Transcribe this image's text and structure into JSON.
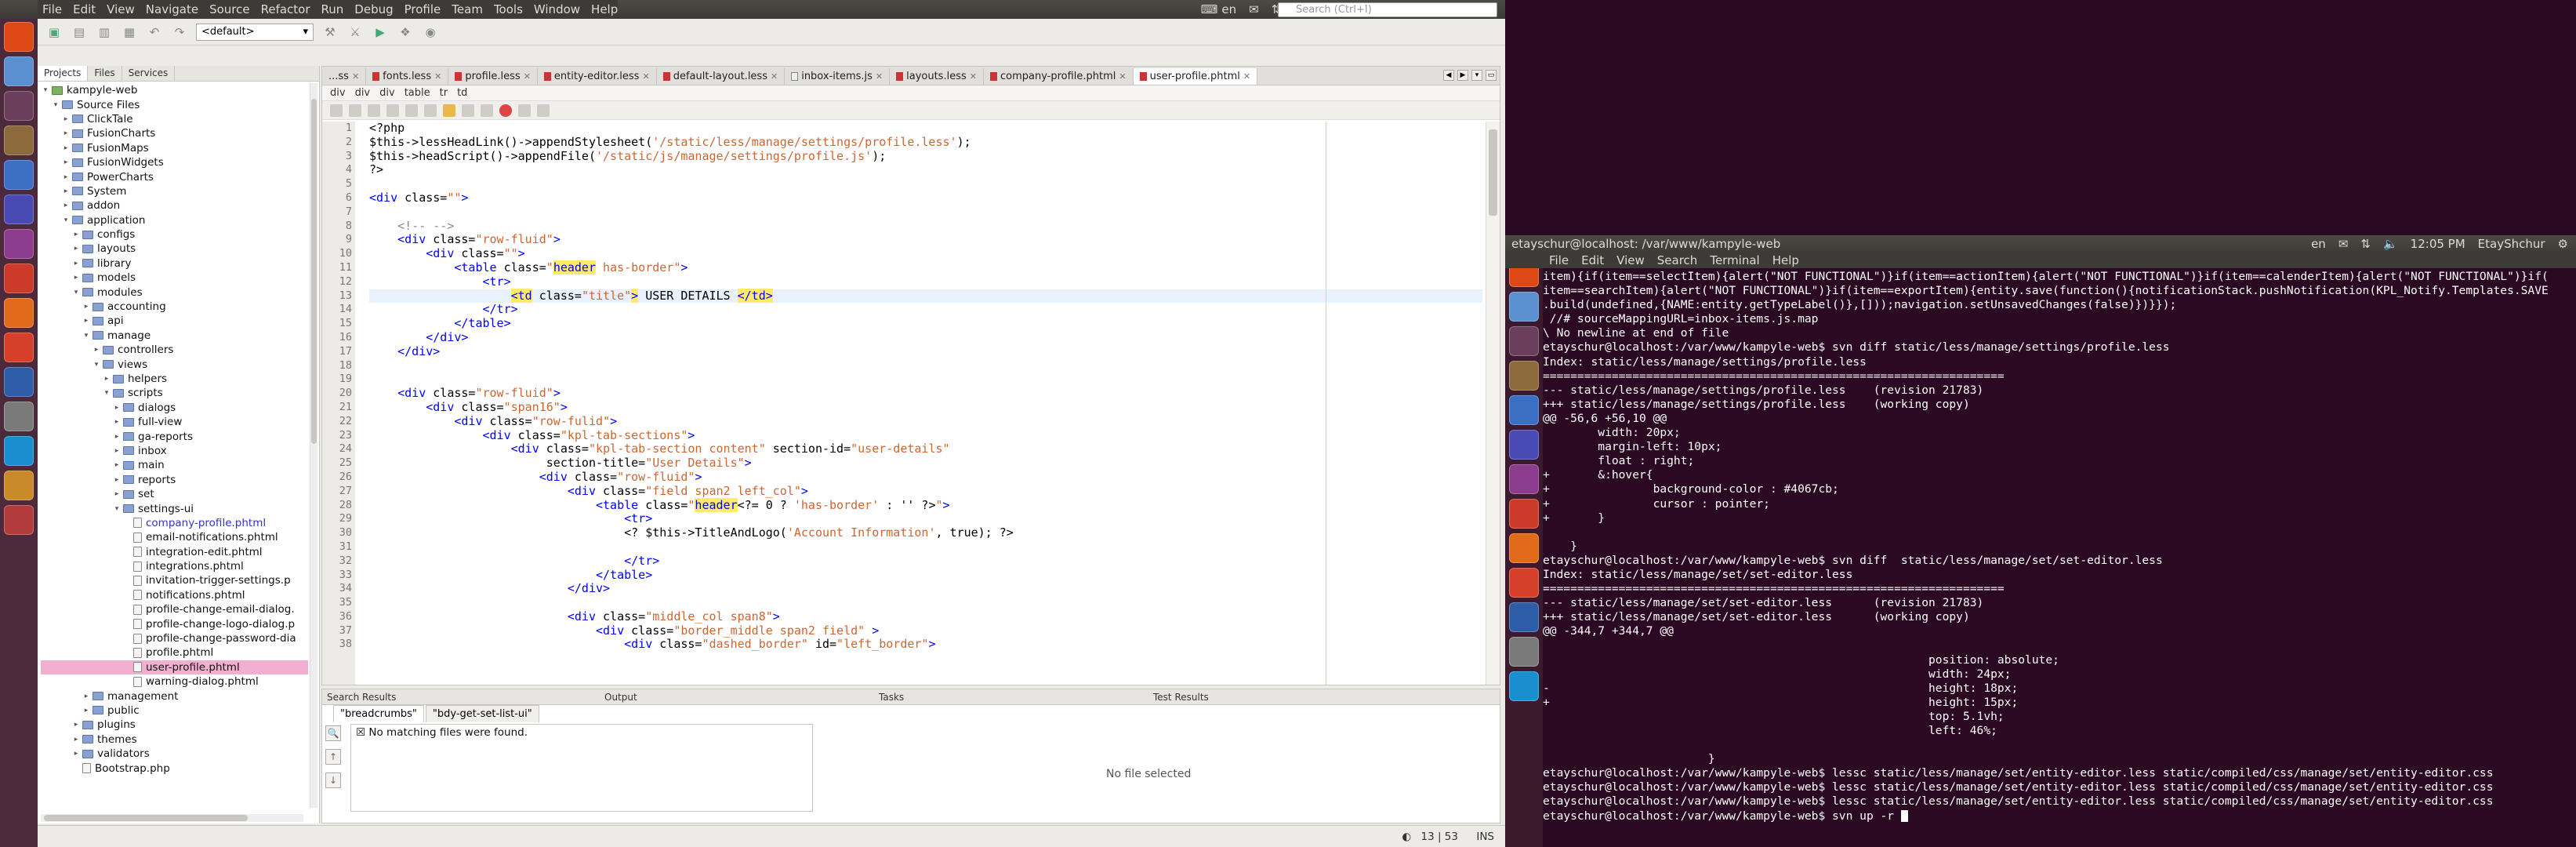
{
  "panel": {
    "keyboard": "en",
    "time": "12:05 PM",
    "user": "EtayShchur"
  },
  "menu": [
    "File",
    "Edit",
    "View",
    "Navigate",
    "Source",
    "Refactor",
    "Run",
    "Debug",
    "Profile",
    "Team",
    "Tools",
    "Window",
    "Help"
  ],
  "search_placeholder": "Search (Ctrl+I)",
  "config_combo": "<default>",
  "panel_tabs": [
    "Projects",
    "Files",
    "Services"
  ],
  "tree": [
    {
      "d": 0,
      "t": "proj",
      "l": "kampyle-web",
      "o": true
    },
    {
      "d": 1,
      "t": "folder",
      "l": "Source Files",
      "o": true
    },
    {
      "d": 2,
      "t": "folder",
      "l": "ClickTale",
      "o": false
    },
    {
      "d": 2,
      "t": "folder",
      "l": "FusionCharts",
      "o": false
    },
    {
      "d": 2,
      "t": "folder",
      "l": "FusionMaps",
      "o": false
    },
    {
      "d": 2,
      "t": "folder",
      "l": "FusionWidgets",
      "o": false
    },
    {
      "d": 2,
      "t": "folder",
      "l": "PowerCharts",
      "o": false
    },
    {
      "d": 2,
      "t": "folder",
      "l": "System",
      "o": false
    },
    {
      "d": 2,
      "t": "folder",
      "l": "addon",
      "o": false
    },
    {
      "d": 2,
      "t": "folder",
      "l": "application",
      "o": true
    },
    {
      "d": 3,
      "t": "folder",
      "l": "configs",
      "o": false
    },
    {
      "d": 3,
      "t": "folder",
      "l": "layouts",
      "o": false
    },
    {
      "d": 3,
      "t": "folder",
      "l": "library",
      "o": false
    },
    {
      "d": 3,
      "t": "folder",
      "l": "models",
      "o": false
    },
    {
      "d": 3,
      "t": "folder",
      "l": "modules",
      "o": true
    },
    {
      "d": 4,
      "t": "folder",
      "l": "accounting",
      "o": false
    },
    {
      "d": 4,
      "t": "folder",
      "l": "api",
      "o": false
    },
    {
      "d": 4,
      "t": "folder",
      "l": "manage",
      "o": true
    },
    {
      "d": 5,
      "t": "folder",
      "l": "controllers",
      "o": false
    },
    {
      "d": 5,
      "t": "folder",
      "l": "views",
      "o": true
    },
    {
      "d": 6,
      "t": "folder",
      "l": "helpers",
      "o": false
    },
    {
      "d": 6,
      "t": "folder",
      "l": "scripts",
      "o": true
    },
    {
      "d": 7,
      "t": "folder",
      "l": "dialogs",
      "o": false
    },
    {
      "d": 7,
      "t": "folder",
      "l": "full-view",
      "o": false
    },
    {
      "d": 7,
      "t": "folder",
      "l": "ga-reports",
      "o": false
    },
    {
      "d": 7,
      "t": "folder",
      "l": "inbox",
      "o": false
    },
    {
      "d": 7,
      "t": "folder",
      "l": "main",
      "o": false
    },
    {
      "d": 7,
      "t": "folder",
      "l": "reports",
      "o": false
    },
    {
      "d": 7,
      "t": "folder",
      "l": "set",
      "o": false
    },
    {
      "d": 7,
      "t": "folder",
      "l": "settings-ui",
      "o": true
    },
    {
      "d": 8,
      "t": "file",
      "l": "company-profile.phtml",
      "f": "open"
    },
    {
      "d": 8,
      "t": "file",
      "l": "email-notifications.phtml"
    },
    {
      "d": 8,
      "t": "file",
      "l": "integration-edit.phtml"
    },
    {
      "d": 8,
      "t": "file",
      "l": "integrations.phtml"
    },
    {
      "d": 8,
      "t": "file",
      "l": "invitation-trigger-settings.p"
    },
    {
      "d": 8,
      "t": "file",
      "l": "notifications.phtml"
    },
    {
      "d": 8,
      "t": "file",
      "l": "profile-change-email-dialog."
    },
    {
      "d": 8,
      "t": "file",
      "l": "profile-change-logo-dialog.p"
    },
    {
      "d": 8,
      "t": "file",
      "l": "profile-change-password-dia"
    },
    {
      "d": 8,
      "t": "file",
      "l": "profile.phtml"
    },
    {
      "d": 8,
      "t": "file",
      "l": "user-profile.phtml",
      "f": "sel"
    },
    {
      "d": 8,
      "t": "file",
      "l": "warning-dialog.phtml"
    },
    {
      "d": 4,
      "t": "folder",
      "l": "management",
      "o": false
    },
    {
      "d": 4,
      "t": "folder",
      "l": "public",
      "o": false
    },
    {
      "d": 3,
      "t": "folder",
      "l": "plugins",
      "o": false
    },
    {
      "d": 3,
      "t": "folder",
      "l": "themes",
      "o": false
    },
    {
      "d": 3,
      "t": "folder",
      "l": "validators",
      "o": false
    },
    {
      "d": 3,
      "t": "file",
      "l": "Bootstrap.php"
    }
  ],
  "editor_tabs": [
    {
      "l": "...ss",
      "ic": ""
    },
    {
      "l": "fonts.less",
      "ic": "less"
    },
    {
      "l": "profile.less",
      "ic": "less"
    },
    {
      "l": "entity-editor.less",
      "ic": "less"
    },
    {
      "l": "default-layout.less",
      "ic": "less"
    },
    {
      "l": "inbox-items.js",
      "ic": "js"
    },
    {
      "l": "layouts.less",
      "ic": "less"
    },
    {
      "l": "company-profile.phtml",
      "ic": "less"
    },
    {
      "l": "user-profile.phtml",
      "ic": "less",
      "on": true
    }
  ],
  "breadcrumbs": [
    "div",
    "div",
    "div",
    "table",
    "tr",
    "td"
  ],
  "code_lines": [
    [
      [
        "php",
        "<?php"
      ]
    ],
    [
      [
        "php",
        "$this->lessHeadLink()->appendStylesheet("
      ],
      [
        "str",
        "'/static/less/manage/settings/profile.less'"
      ],
      [
        "php",
        ");"
      ]
    ],
    [
      [
        "php",
        "$this->headScript()->appendFile("
      ],
      [
        "str",
        "'/static/js/manage/settings/profile.js'"
      ],
      [
        "php",
        ");"
      ]
    ],
    [
      [
        "php",
        "?>"
      ]
    ],
    [],
    [
      [
        "tag",
        "<div "
      ],
      [
        "attr",
        "class="
      ],
      [
        "str",
        "\"\""
      ],
      [
        "tag",
        ">"
      ]
    ],
    [],
    [
      [
        "cm",
        "    <!-- -->"
      ]
    ],
    [
      [
        "tag",
        "    <div "
      ],
      [
        "attr",
        "class="
      ],
      [
        "str",
        "\"row-fluid\""
      ],
      [
        "tag",
        ">"
      ]
    ],
    [
      [
        "tag",
        "        <div "
      ],
      [
        "attr",
        "class="
      ],
      [
        "str",
        "\"\""
      ],
      [
        "tag",
        ">"
      ]
    ],
    [
      [
        "tag",
        "            <table "
      ],
      [
        "attr",
        "class="
      ],
      [
        "str",
        "\""
      ],
      [
        "hl",
        "header"
      ],
      [
        "str",
        " has-border\""
      ],
      [
        "tag",
        ">"
      ]
    ],
    [
      [
        "tag",
        "                <tr>"
      ]
    ],
    [
      [
        "tag",
        "                    "
      ],
      [
        "hl",
        "<td"
      ],
      [
        "attr",
        " class="
      ],
      [
        "str",
        "\"title\""
      ],
      [
        "hl",
        ">"
      ],
      [
        "php",
        " USER DETAILS "
      ],
      [
        "hl",
        "</td>"
      ]
    ],
    [
      [
        "tag",
        "                </tr>"
      ]
    ],
    [
      [
        "tag",
        "            </table>"
      ]
    ],
    [
      [
        "tag",
        "        </div>"
      ]
    ],
    [
      [
        "tag",
        "    </div>"
      ]
    ],
    [],
    [],
    [
      [
        "tag",
        "    <div "
      ],
      [
        "attr",
        "class="
      ],
      [
        "str",
        "\"row-fluid\""
      ],
      [
        "tag",
        ">"
      ]
    ],
    [
      [
        "tag",
        "        <div "
      ],
      [
        "attr",
        "class="
      ],
      [
        "str",
        "\"span16\""
      ],
      [
        "tag",
        ">"
      ]
    ],
    [
      [
        "tag",
        "            <div "
      ],
      [
        "attr",
        "class="
      ],
      [
        "str",
        "\"row-fulid\""
      ],
      [
        "tag",
        ">"
      ]
    ],
    [
      [
        "tag",
        "                <div "
      ],
      [
        "attr",
        "class="
      ],
      [
        "str",
        "\"kpl-tab-sections\""
      ],
      [
        "tag",
        ">"
      ]
    ],
    [
      [
        "tag",
        "                    <div "
      ],
      [
        "attr",
        "class="
      ],
      [
        "str",
        "\"kpl-tab-section content\""
      ],
      [
        "attr",
        " section-id="
      ],
      [
        "str",
        "\"user-details\""
      ]
    ],
    [
      [
        "attr",
        "                         section-title="
      ],
      [
        "str",
        "\"User Details\""
      ],
      [
        "tag",
        ">"
      ]
    ],
    [
      [
        "tag",
        "                        <div "
      ],
      [
        "attr",
        "class="
      ],
      [
        "str",
        "\"row-fluid\""
      ],
      [
        "tag",
        ">"
      ]
    ],
    [
      [
        "tag",
        "                            <div "
      ],
      [
        "attr",
        "class="
      ],
      [
        "str",
        "\"field span2 left_col\""
      ],
      [
        "tag",
        ">"
      ]
    ],
    [
      [
        "tag",
        "                                <table "
      ],
      [
        "attr",
        "class="
      ],
      [
        "str",
        "\""
      ],
      [
        "hl",
        "header"
      ],
      [
        "php",
        "<?= 0 ? "
      ],
      [
        "str",
        "'has-border'"
      ],
      [
        "php",
        " : '' ?>"
      ],
      [
        "str",
        "\""
      ],
      [
        "tag",
        ">"
      ]
    ],
    [
      [
        "tag",
        "                                    <tr>"
      ]
    ],
    [
      [
        "php",
        "                                    <? $this->TitleAndLogo("
      ],
      [
        "str",
        "'Account Information'"
      ],
      [
        "php",
        ", true); ?>"
      ]
    ],
    [],
    [
      [
        "tag",
        "                                    </tr>"
      ]
    ],
    [
      [
        "tag",
        "                                </table>"
      ]
    ],
    [
      [
        "tag",
        "                            </div>"
      ]
    ],
    [],
    [
      [
        "tag",
        "                            <div "
      ],
      [
        "attr",
        "class="
      ],
      [
        "str",
        "\"middle_col span8\""
      ],
      [
        "tag",
        ">"
      ]
    ],
    [
      [
        "tag",
        "                                <div "
      ],
      [
        "attr",
        "class="
      ],
      [
        "str",
        "\"border_middle span2 field\""
      ],
      [
        "tag",
        " >"
      ]
    ],
    [
      [
        "tag",
        "                                    <div "
      ],
      [
        "attr",
        "class="
      ],
      [
        "str",
        "\"dashed_border\""
      ],
      [
        "attr",
        " id="
      ],
      [
        "str",
        "\"left_border\""
      ],
      [
        "tag",
        ">"
      ]
    ]
  ],
  "bottom": {
    "search_title": "Search Results",
    "output_title": "Output",
    "tasks_title": "Tasks",
    "tests_title": "Test Results",
    "subtabs": [
      "\"breadcrumbs\"",
      "\"bdy-get-set-list-ui\""
    ],
    "no_match": "No matching files were found.",
    "no_file": "No file selected"
  },
  "status": {
    "pos": "13 | 53",
    "mode": "INS"
  },
  "terminal": {
    "title": "etayschur@localhost: /var/www/kampyle-web",
    "menu": [
      "File",
      "Edit",
      "View",
      "Search",
      "Terminal",
      "Help"
    ],
    "lines": [
      "item){if(item==selectItem){alert(\"NOT FUNCTIONAL\")}if(item==actionItem){alert(\"NOT FUNCTIONAL\")}if(item==calenderItem){alert(\"NOT FUNCTIONAL\")}if(",
      "item==searchItem){alert(\"NOT FUNCTIONAL\")}if(item==exportItem){entity.save(function(){notificationStack.pushNotification(KPL_Notify.Templates.SAVE",
      ".build(undefined,{NAME:entity.getTypeLabel()},[]));navigation.setUnsavedChanges(false)})}});",
      " //# sourceMappingURL=inbox-items.js.map",
      "\\ No newline at end of file",
      "etayschur@localhost:/var/www/kampyle-web$ svn diff static/less/manage/settings/profile.less",
      "Index: static/less/manage/settings/profile.less",
      "===================================================================",
      "--- static/less/manage/settings/profile.less    (revision 21783)",
      "+++ static/less/manage/settings/profile.less    (working copy)",
      "@@ -56,6 +56,10 @@",
      "        width: 20px;",
      "        margin-left: 10px;",
      "        float : right;",
      "+       &:hover{",
      "+               background-color : #4067cb;",
      "+               cursor : pointer;",
      "+       }",
      "",
      "    }",
      "etayschur@localhost:/var/www/kampyle-web$ svn diff  static/less/manage/set/set-editor.less",
      "Index: static/less/manage/set/set-editor.less",
      "===================================================================",
      "--- static/less/manage/set/set-editor.less      (revision 21783)",
      "+++ static/less/manage/set/set-editor.less      (working copy)",
      "@@ -344,7 +344,7 @@",
      "",
      "                                                        position: absolute;",
      "                                                        width: 24px;",
      "-                                                       height: 18px;",
      "+                                                       height: 15px;",
      "                                                        top: 5.1vh;",
      "                                                        left: 46%;",
      "",
      "                        }",
      "etayschur@localhost:/var/www/kampyle-web$ lessc static/less/manage/set/entity-editor.less static/compiled/css/manage/set/entity-editor.css",
      "etayschur@localhost:/var/www/kampyle-web$ lessc static/less/manage/set/entity-editor.less static/compiled/css/manage/set/entity-editor.css",
      "etayschur@localhost:/var/www/kampyle-web$ lessc static/less/manage/set/entity-editor.less static/compiled/css/manage/set/entity-editor.css",
      "etayschur@localhost:/var/www/kampyle-web$ svn up -r "
    ]
  },
  "launcher_colors": [
    "#dd4814",
    "#5a8fd0",
    "#6b3f5c",
    "#8c6a3c",
    "#3a6fc4",
    "#4a4ab5",
    "#8c3c8c",
    "#cc3a2a",
    "#e26b1b",
    "#d6402a",
    "#2e5da8",
    "#7a7a7a",
    "#1a8fd0",
    "#c98a2a",
    "#b23c3c"
  ]
}
